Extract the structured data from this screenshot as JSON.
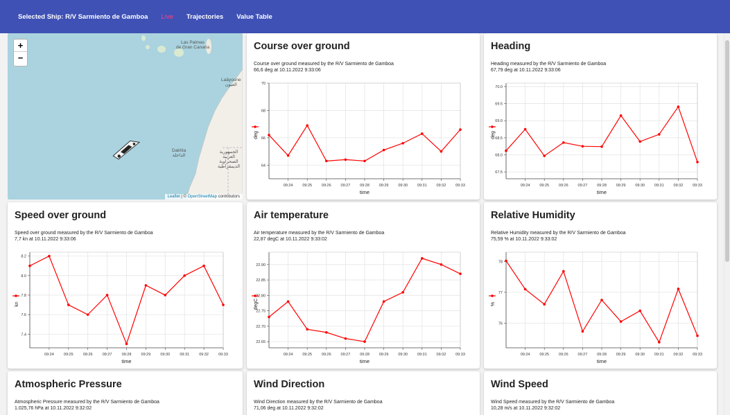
{
  "nav": {
    "selected_ship": "Selected Ship: R/V Sarmiento de Gamboa",
    "live": "Live",
    "trajectories": "Trajectories",
    "value_table": "Value Table"
  },
  "map": {
    "zoom_in": "+",
    "zoom_out": "−",
    "label_las_palmas": "Las Palmas",
    "label_gran_canaria": "de Gran Canaria",
    "label_laayoune": "Laâyoune",
    "label_laayoune_ar": "العيون",
    "label_dakhla": "Dakhla",
    "label_dakhla_ar": "الداخلة",
    "label_sahara_ar": "الجمهورية العربية الصحراوية الديمقراطية",
    "attribution_leaflet": "Leaflet",
    "attribution_sep": " | © ",
    "attribution_osm": "OpenStreetMap",
    "attribution_tail": " contributors"
  },
  "colors": {
    "nav_bg": "#3f51b5",
    "live": "#ff4081",
    "series": "#ff0000",
    "water": "#aad3df",
    "land": "#f2efe9"
  },
  "cards": [
    {
      "id": "cog",
      "title": "Course over ground",
      "desc1": "Course over ground measured by the R/V Sarmiento de Gamboa",
      "desc2": "66,6 deg at 10.11.2022 9:33:06"
    },
    {
      "id": "heading",
      "title": "Heading",
      "desc1": "Heading measured by the R/V Sarmiento de Gamboa",
      "desc2": "67,79 deg at 10.11.2022 9:33:06"
    },
    {
      "id": "sog",
      "title": "Speed over ground",
      "desc1": "Speed over ground measured by the R/V Sarmiento de Gamboa",
      "desc2": "7,7 kn at 10.11.2022 9:33:06"
    },
    {
      "id": "airtemp",
      "title": "Air temperature",
      "desc1": "Air temperature measured by the R/V Sarmiento de Gamboa",
      "desc2": "22,87 degC at 10.11.2022 9:33:02"
    },
    {
      "id": "humidity",
      "title": "Relative Humidity",
      "desc1": "Relative Humidity measured by the R/V Sarmiento de Gamboa",
      "desc2": "75,59 % at 10.11.2022 9:33:02"
    },
    {
      "id": "pressure",
      "title": "Atmospheric Pressure",
      "desc1": "Atmospheric Pressure measured by the R/V Sarmiento de Gamboa",
      "desc2": "1.025,76 hPa at 10.11.2022 9:32:02"
    },
    {
      "id": "winddir",
      "title": "Wind Direction",
      "desc1": "Wind Direction measured by the R/V Sarmiento de Gamboa",
      "desc2": "71,06 deg at 10.11.2022 9:32:02"
    },
    {
      "id": "windspeed",
      "title": "Wind Speed",
      "desc1": "Wind Speed measured by the R/V Sarmiento de Gamboa",
      "desc2": "10,28 m/s at 10.11.2022 9:32:02"
    }
  ],
  "chart_data": [
    {
      "type": "line",
      "card": "cog",
      "xlabel": "time",
      "ylabel": "deg",
      "x": [
        "09:23:06",
        "09:23:36",
        "09:24:06",
        "09:24:36",
        "09:25:06",
        "09:25:36",
        "09:26:06",
        "09:26:36",
        "09:27:06",
        "09:27:36",
        "09:28:06",
        "09:28:36",
        "09:29:06",
        "09:29:36",
        "09:30:06",
        "09:30:36",
        "09:31:06",
        "09:31:36",
        "09:32:06",
        "09:32:36",
        "09:33:06"
      ],
      "series": [
        {
          "values": [
            66.2,
            64.7,
            66.9,
            64.3,
            64.4,
            64.3,
            65.1,
            65.6,
            66.3,
            65.0,
            66.6
          ]
        }
      ],
      "x_ticks": [
        "09:24",
        "09:25",
        "09:26",
        "09:27",
        "09:28",
        "09:29",
        "09:30",
        "09:31",
        "09:32",
        "09:33"
      ],
      "y_ticks": [
        "70",
        "68",
        "66",
        "64"
      ],
      "ylim": [
        63,
        70
      ],
      "grid": true,
      "legend": "left"
    },
    {
      "type": "line",
      "card": "heading",
      "xlabel": "time",
      "ylabel": "deg",
      "series": [
        {
          "values": [
            68.12,
            68.75,
            67.97,
            68.36,
            68.25,
            68.24,
            69.15,
            68.39,
            68.6,
            69.41,
            67.79
          ]
        }
      ],
      "x_ticks": [
        "09:24",
        "09:25",
        "09:26",
        "09:27",
        "09:28",
        "09:29",
        "09:30",
        "09:31",
        "09:32",
        "09:33"
      ],
      "y_ticks": [
        "70.0",
        "69.5",
        "69.0",
        "68.5",
        "68.0",
        "67.5"
      ],
      "ylim": [
        67.3,
        70.1
      ],
      "grid": true,
      "legend": "left"
    },
    {
      "type": "line",
      "card": "sog",
      "xlabel": "time",
      "ylabel": "kn",
      "series": [
        {
          "values": [
            8.1,
            8.2,
            7.7,
            7.6,
            7.8,
            7.3,
            7.9,
            7.8,
            8.0,
            8.1,
            7.7
          ]
        }
      ],
      "x_ticks": [
        "09:24",
        "09:25",
        "09:26",
        "09:27",
        "09:28",
        "09:29",
        "09:30",
        "09:31",
        "09:32",
        "09:33"
      ],
      "y_ticks": [
        "8.2",
        "8.0",
        "7.8",
        "7.6",
        "7.4"
      ],
      "ylim": [
        7.26,
        8.24
      ],
      "grid": true,
      "legend": "left"
    },
    {
      "type": "line",
      "card": "airtemp",
      "xlabel": "time",
      "ylabel": "degC",
      "series": [
        {
          "values": [
            22.73,
            22.78,
            22.69,
            22.68,
            22.66,
            22.65,
            22.78,
            22.81,
            22.92,
            22.9,
            22.87
          ]
        }
      ],
      "x_ticks": [
        "09:24",
        "09:25",
        "09:26",
        "09:27",
        "09:28",
        "09:29",
        "09:30",
        "09:31",
        "09:32",
        "09:33"
      ],
      "y_ticks": [
        "22.90",
        "22.85",
        "22.80",
        "22.75",
        "22.70",
        "22.65"
      ],
      "ylim": [
        22.63,
        22.94
      ],
      "grid": true,
      "legend": "left"
    },
    {
      "type": "line",
      "card": "humidity",
      "xlabel": "time",
      "ylabel": "%",
      "series": [
        {
          "values": [
            78.02,
            77.1,
            76.61,
            77.68,
            75.73,
            76.75,
            76.05,
            76.4,
            75.38,
            77.11,
            75.59
          ]
        }
      ],
      "x_ticks": [
        "09:24",
        "09:25",
        "09:26",
        "09:27",
        "09:28",
        "09:29",
        "09:30",
        "09:31",
        "09:32",
        "09:33"
      ],
      "y_ticks": [
        "78",
        "77",
        "76"
      ],
      "ylim": [
        75.2,
        78.3
      ],
      "grid": true,
      "legend": "left"
    }
  ]
}
